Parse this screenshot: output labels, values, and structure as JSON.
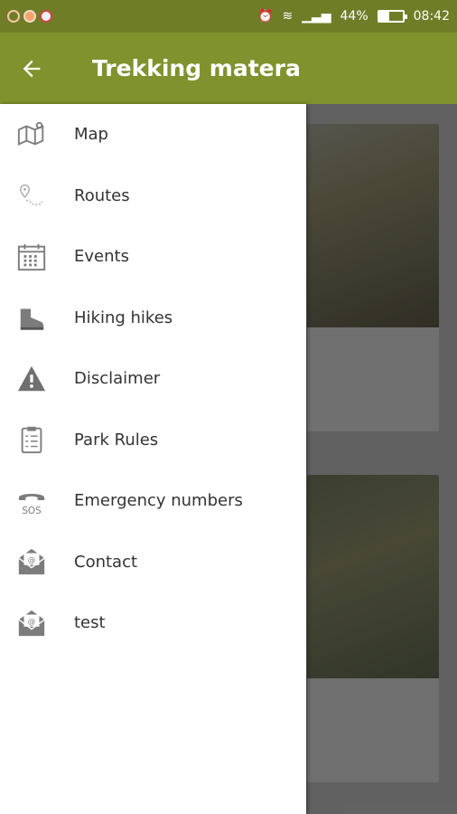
{
  "status_bar": {
    "battery_text": "44%",
    "time": "08:42",
    "battery_level": 0.44
  },
  "app_bar": {
    "back_icon": "arrow-back-icon",
    "title": "Trekking matera"
  },
  "drawer": {
    "items": [
      {
        "label": "Map",
        "icon": "map-icon"
      },
      {
        "label": "Routes",
        "icon": "route-icon"
      },
      {
        "label": "Events",
        "icon": "calendar-icon"
      },
      {
        "label": "Hiking hikes",
        "icon": "boot-icon"
      },
      {
        "label": "Disclaimer",
        "icon": "warning-icon"
      },
      {
        "label": "Park Rules",
        "icon": "clipboard-icon"
      },
      {
        "label": "Emergency numbers",
        "icon": "sos-phone-icon"
      },
      {
        "label": "Contact",
        "icon": "mail-icon"
      },
      {
        "label": "test",
        "icon": "mail-icon"
      }
    ]
  },
  "colors": {
    "status_bar": "#6f7d27",
    "app_bar": "#7f922d",
    "icon_gray": "#7c7c7c"
  }
}
